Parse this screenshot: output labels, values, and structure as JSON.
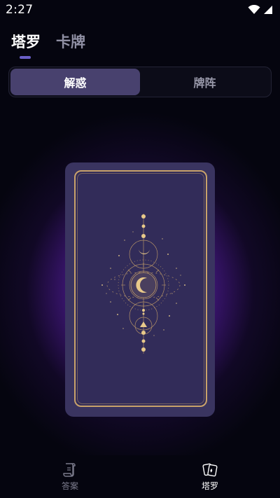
{
  "status_bar": {
    "time": "2:27",
    "icons": [
      "wifi-icon",
      "signal-icon"
    ]
  },
  "top_tabs": [
    {
      "label": "塔罗",
      "active": true
    },
    {
      "label": "卡牌",
      "active": false
    }
  ],
  "segmented": [
    {
      "label": "解惑",
      "active": true
    },
    {
      "label": "牌阵",
      "active": false
    }
  ],
  "card": {
    "icon": "moon-phases-icon",
    "border_color": "#c9a26a",
    "face_color": "#322c59"
  },
  "bottom_nav": [
    {
      "label": "答案",
      "icon": "scroll-icon",
      "active": false
    },
    {
      "label": "塔罗",
      "icon": "tarot-cards-icon",
      "active": true
    }
  ],
  "colors": {
    "accent": "#6a5fc7",
    "glow": "#8a2be2",
    "background": "#05050f"
  }
}
